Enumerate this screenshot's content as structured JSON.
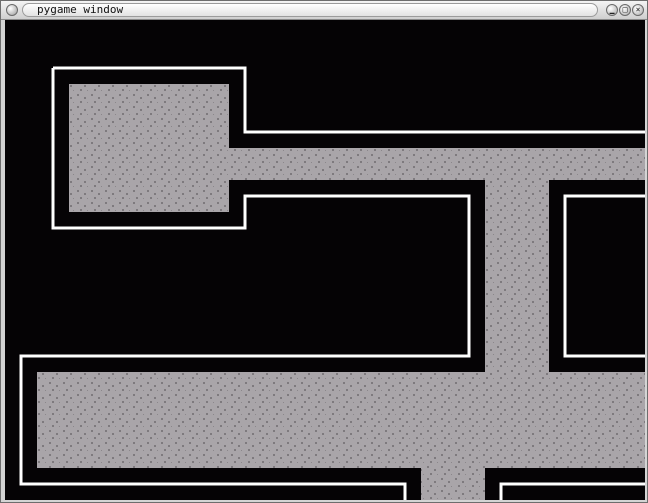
{
  "window": {
    "title": "pygame window",
    "menu_icon": "circle-menu-icon",
    "buttons": {
      "minimize_icon": "minimize-icon",
      "maximize_icon": "maximize-icon",
      "close_icon": "close-icon"
    }
  },
  "game": {
    "colors": {
      "background": "#050305",
      "floor": "#a9a5a9",
      "floor_speckle": "#7e7a7e",
      "wall_line": "#ffffff"
    }
  }
}
